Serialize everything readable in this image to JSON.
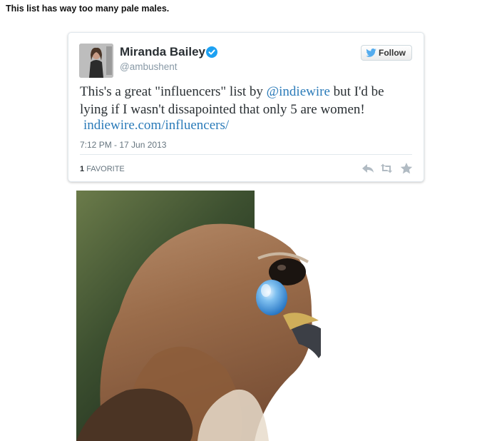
{
  "post": {
    "title": "This list has way too many pale males."
  },
  "tweet": {
    "author_name": "Miranda Bailey",
    "handle": "@ambushent",
    "follow_label": "Follow",
    "text_before": "This's a great \"influencers\" list by ",
    "mention": "@indiewire",
    "text_after": " but I'd be lying if I wasn't dissapointed that only 5 are women!",
    "link": "indiewire.com/influencers/",
    "timestamp": "7:12 PM - 17 Jun 2013",
    "favorites_count": "1",
    "favorites_label": "FAVORITE"
  },
  "colors": {
    "link": "#2b7bb9",
    "verified": "#1da1f2",
    "twitter_bird": "#55acee",
    "muted": "#8899a6"
  },
  "icons": [
    "verified-badge-icon",
    "twitter-bird-icon",
    "reply-icon",
    "retweet-icon",
    "favorite-star-icon"
  ]
}
